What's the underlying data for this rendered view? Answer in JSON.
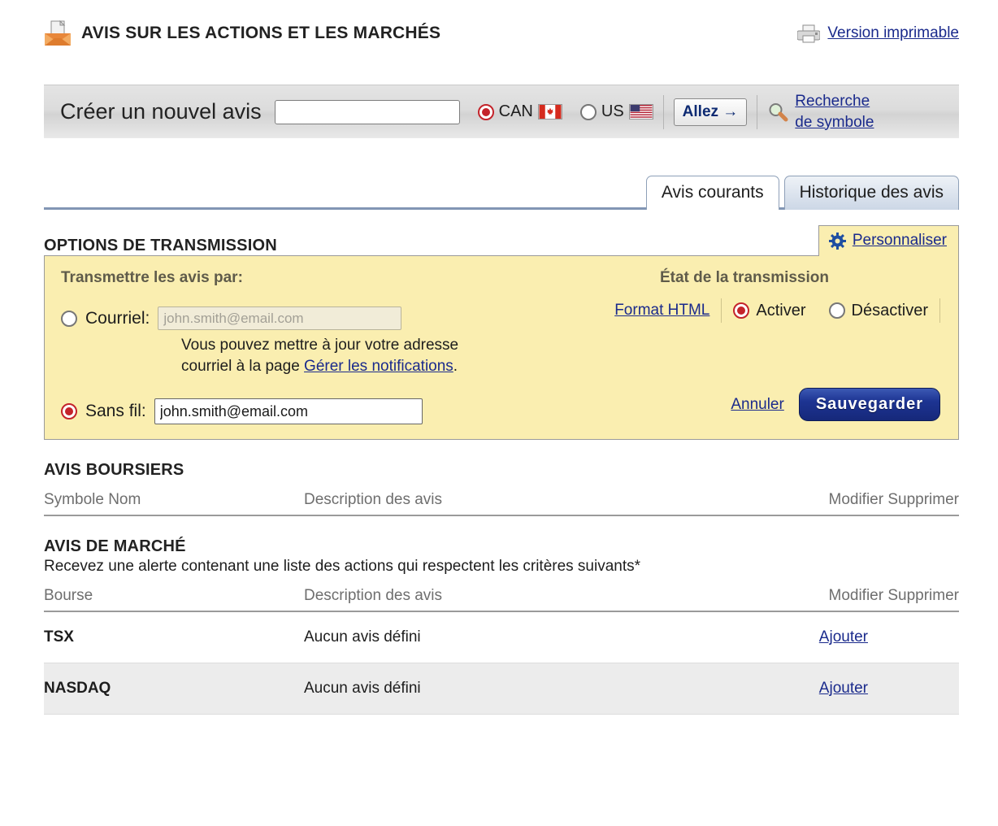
{
  "header": {
    "title": "AVIS SUR LES ACTIONS ET LES MARCHÉS",
    "doc_icon": "document-envelope-icon",
    "printer_icon": "printer-icon",
    "print_link": "Version imprimable"
  },
  "search": {
    "label": "Créer un nouvel avis",
    "symbol_value": "",
    "symbol_placeholder": "",
    "markets": [
      {
        "id": "can",
        "label": "CAN",
        "selected": true,
        "flag": "canada-flag-icon"
      },
      {
        "id": "us",
        "label": "US",
        "selected": false,
        "flag": "usa-flag-icon"
      }
    ],
    "go_label": "Allez →",
    "symbol_search_icon": "magnifier-icon",
    "symbol_search_line1": "Recherche",
    "symbol_search_line2": "de symbole"
  },
  "tabs": [
    {
      "label": "Avis courants",
      "active": true
    },
    {
      "label": "Historique des avis",
      "active": false
    }
  ],
  "transmission": {
    "section_title": "OPTIONS DE TRANSMISSION",
    "customize_icon": "gear-icon",
    "customize_label": "Personnaliser",
    "deliver_heading": "Transmettre les avis par:",
    "email_option_label": "Courriel:",
    "email_selected": false,
    "email_value": "john.smith@email.com",
    "email_disabled": true,
    "hint_text_1": "Vous pouvez mettre à jour votre adresse courriel à la page ",
    "hint_link": "Gérer les notifications",
    "hint_text_2": ".",
    "wireless_option_label": "Sans fil:",
    "wireless_selected": true,
    "wireless_value": "john.smith@email.com",
    "state_heading": "État de la transmission",
    "format_link": "Format HTML",
    "state_options": [
      {
        "label": "Activer",
        "selected": true
      },
      {
        "label": "Désactiver",
        "selected": false
      }
    ],
    "cancel_label": "Annuler",
    "save_label": "Sauvegarder"
  },
  "stock_alerts": {
    "title": "AVIS BOURSIERS",
    "columns": [
      "Symbole Nom",
      "Description des avis",
      "Modifier Supprimer"
    ],
    "rows": []
  },
  "market_alerts": {
    "title": "AVIS DE MARCHÉ",
    "subtitle": "Recevez une alerte contenant une liste des actions qui respectent les critères suivants*",
    "columns": [
      "Bourse",
      "Description des avis",
      "Modifier Supprimer"
    ],
    "rows": [
      {
        "exchange": "TSX",
        "description": "Aucun avis défini",
        "action": "Ajouter"
      },
      {
        "exchange": "NASDAQ",
        "description": "Aucun avis défini",
        "action": "Ajouter"
      }
    ]
  },
  "colors": {
    "panel_bg": "#faeeb0",
    "link": "#1a2a8c",
    "radio_on": "#c4232a",
    "tab_border": "#8ea0b8",
    "save_button": "#1d3492"
  }
}
